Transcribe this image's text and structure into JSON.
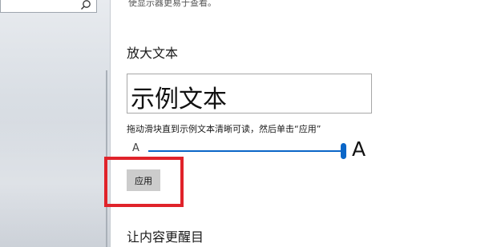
{
  "sidebar": {
    "search_icon": "search-icon"
  },
  "page": {
    "description_partial": "使显示器更易于查看。",
    "section_title": "放大文本",
    "sample_text": "示例文本",
    "instruction": "拖动滑块直到示例文本清晰可读，然后单击“应用”",
    "slider": {
      "min_label": "A",
      "max_label": "A",
      "level": 1.0
    },
    "apply_label": "应用",
    "next_section_title": "让内容更醒目"
  },
  "colors": {
    "accent": "#0a66c8",
    "highlight": "#e0232a",
    "button_bg": "#cccccc"
  }
}
